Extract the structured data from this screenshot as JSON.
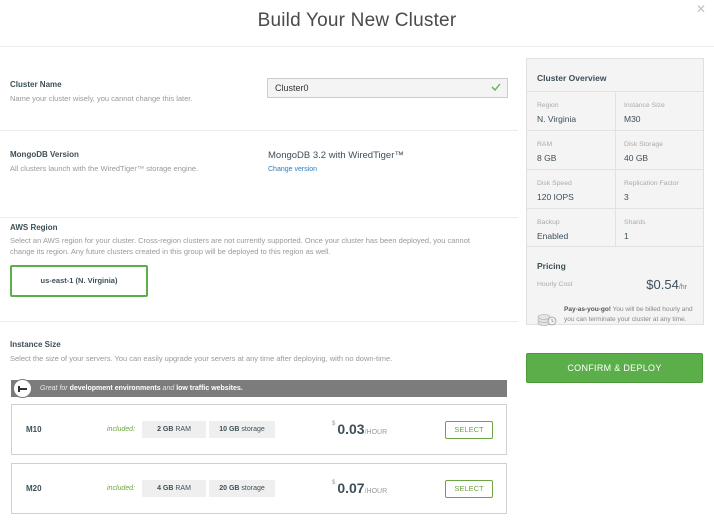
{
  "modal": {
    "title": "Build Your New Cluster",
    "close": "✕"
  },
  "cluster_name": {
    "label": "Cluster Name",
    "help": "Name your cluster wisely, you cannot change this later.",
    "value": "Cluster0"
  },
  "mongodb_version": {
    "label": "MongoDB Version",
    "help": "All clusters launch with the WiredTiger™ storage engine.",
    "value": "MongoDB 3.2 with WiredTiger™",
    "change_link": "Change version"
  },
  "aws_region": {
    "label": "AWS Region",
    "help": "Select an AWS region for your cluster. Cross-region clusters are not currently supported. Once your cluster has been deployed, you cannot change its region. Any future clusters created in this group will be deployed to this region as well.",
    "selected": "us-east-1  (N. Virginia)"
  },
  "instance_size": {
    "label": "Instance Size",
    "help": "Select the size of your servers. You can easily upgrade your servers at any time after deploying, with no down-time.",
    "banner": {
      "prefix": "Great for ",
      "b1": "development environments",
      "mid": " and ",
      "b2": "low traffic websites."
    },
    "instances": [
      {
        "name": "M10",
        "included": "included:",
        "ram": "2 GB",
        "ram_unit": " RAM",
        "storage": "10 GB",
        "storage_unit": " storage",
        "currency": "$",
        "price": "0.03",
        "per": "/HOUR",
        "select": "SELECT"
      },
      {
        "name": "M20",
        "included": "included:",
        "ram": "4 GB",
        "ram_unit": " RAM",
        "storage": "20 GB",
        "storage_unit": " storage",
        "currency": "$",
        "price": "0.07",
        "per": "/HOUR",
        "select": "SELECT"
      }
    ]
  },
  "overview": {
    "title": "Cluster Overview",
    "rows": [
      [
        {
          "key": "Region",
          "value": "N. Virginia"
        },
        {
          "key": "Instance Size",
          "value": "M30"
        }
      ],
      [
        {
          "key": "RAM",
          "value": "8 GB"
        },
        {
          "key": "Disk Storage",
          "value": "40 GB"
        }
      ],
      [
        {
          "key": "Disk Speed",
          "value": "120 IOPS"
        },
        {
          "key": "Replication Factor",
          "value": "3"
        }
      ],
      [
        {
          "key": "Backup",
          "value": "Enabled"
        },
        {
          "key": "Shards",
          "value": "1"
        }
      ]
    ],
    "pricing": {
      "title": "Pricing",
      "hourly_label": "Hourly Cost",
      "hourly_value": "$0.54",
      "hourly_unit": "/hr",
      "payg_bold": "Pay-as-you-go!",
      "payg_text": " You will be billed hourly and you can terminate your cluster at any time."
    }
  },
  "confirm_button": "CONFIRM & DEPLOY",
  "colors": {
    "accent_green": "#5cae4a",
    "link_blue": "#2e7cbf",
    "banner_gray": "#7c7c7c"
  }
}
